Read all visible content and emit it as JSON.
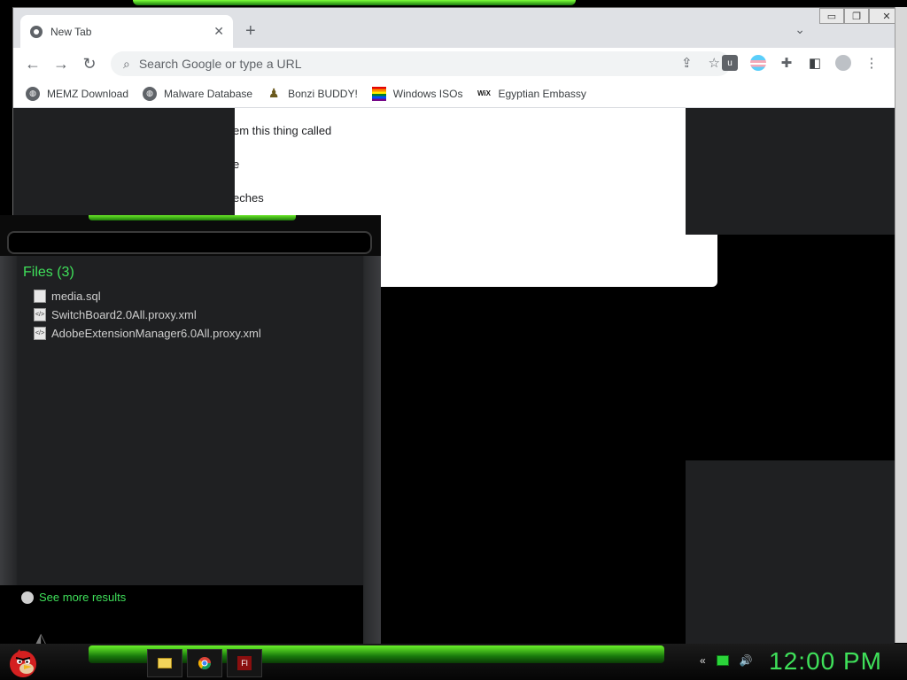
{
  "browser": {
    "tab_title": "New Tab",
    "omnibox_placeholder": "Search Google or type a URL",
    "bookmarks": [
      {
        "label": "MEMZ Download",
        "icon": "globe-icon"
      },
      {
        "label": "Malware Database",
        "icon": "globe-icon"
      },
      {
        "label": "Bonzi BUDDY!",
        "icon": "bonzi-icon"
      },
      {
        "label": "Windows ISOs",
        "icon": "rainbow-flag-icon"
      },
      {
        "label": "Egyptian Embassy",
        "icon": "wix-icon"
      }
    ],
    "page_lines": [
      "em this thing called",
      "e",
      "eches"
    ]
  },
  "start_menu": {
    "files_header": "Files (3)",
    "files": [
      {
        "name": "media.sql"
      },
      {
        "name": "SwitchBoard2.0All.proxy.xml"
      },
      {
        "name": "AdobeExtensionManager6.0All.proxy.xml"
      }
    ],
    "see_more": "See more results"
  },
  "taskbar": {
    "clock": "12:00 PM",
    "apps": [
      "file-explorer-icon",
      "chrome-icon",
      "flash-icon"
    ]
  },
  "colors": {
    "accent_green": "#3fe05a",
    "glow_green": "#6af22a"
  }
}
